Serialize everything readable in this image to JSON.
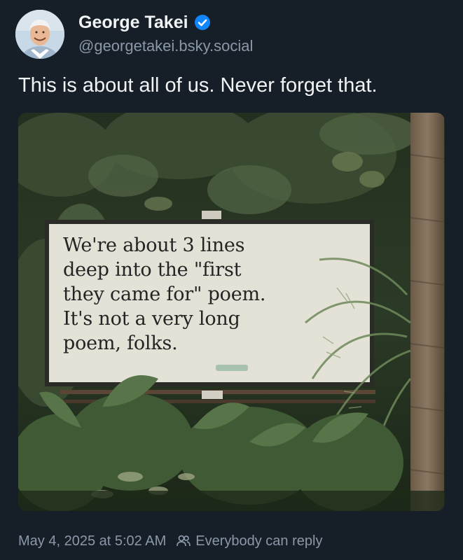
{
  "author": {
    "display_name": "George Takei",
    "handle": "@georgetakei.bsky.social",
    "verified": true
  },
  "post": {
    "text": "This is about all of us. Never forget that.",
    "image": {
      "sign_text": "We're about 3 lines\ndeep into the \"first\nthey came for\" poem.\nIt's not a very long\npoem, folks."
    }
  },
  "footer": {
    "timestamp": "May 4, 2025 at 5:02 AM",
    "reply_setting": "Everybody can reply",
    "reply_icon": "people-icon"
  },
  "colors": {
    "background": "#161e27",
    "text_primary": "#f1f3f5",
    "text_secondary": "#8a98a8",
    "verified_blue": "#1185fe"
  }
}
